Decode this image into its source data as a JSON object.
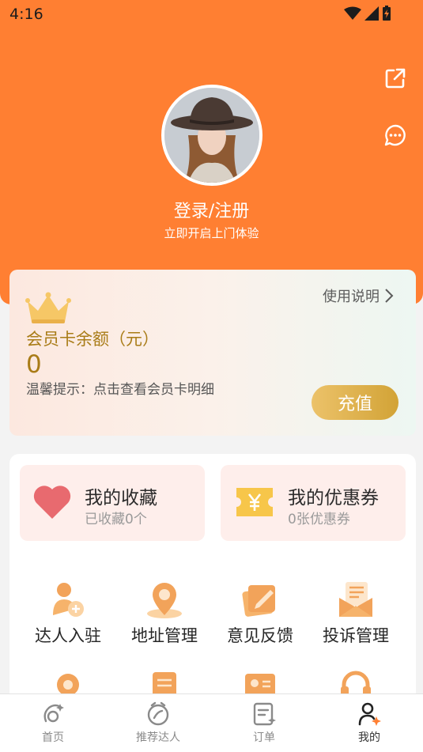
{
  "status": {
    "time": "4:16"
  },
  "profile": {
    "login": "登录/注册",
    "subtitle": "立即开启上门体验"
  },
  "member_card": {
    "usage_link": "使用说明",
    "title": "会员卡余额（元）",
    "balance": "0",
    "tip": "温馨提示：点击查看会员卡明细",
    "recharge": "充值"
  },
  "quick": [
    {
      "title": "我的收藏",
      "sub": "已收藏0个",
      "icon": "heart-icon"
    },
    {
      "title": "我的优惠券",
      "sub": "0张优惠券",
      "icon": "coupon-icon"
    }
  ],
  "services": [
    {
      "label": "达人入驻",
      "icon": "talent-join-icon"
    },
    {
      "label": "地址管理",
      "icon": "address-icon"
    },
    {
      "label": "意见反馈",
      "icon": "feedback-icon"
    },
    {
      "label": "投诉管理",
      "icon": "complaint-icon"
    }
  ],
  "tabs": [
    {
      "label": "首页",
      "icon": "home-icon"
    },
    {
      "label": "推荐达人",
      "icon": "recommend-icon"
    },
    {
      "label": "订单",
      "icon": "order-icon"
    },
    {
      "label": "我的",
      "icon": "mine-icon",
      "active": true
    }
  ],
  "colors": {
    "primary": "#ff7f32",
    "gold": "#a97c17",
    "heart": "#e86a6f",
    "coupon": "#f7c64a"
  }
}
